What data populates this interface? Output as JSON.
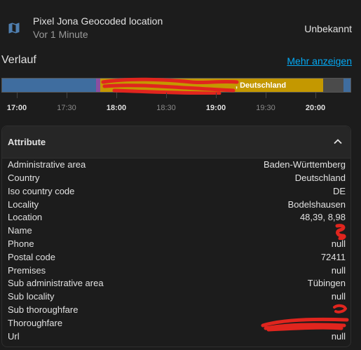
{
  "entity": {
    "name": "Pixel Jona Geocoded location",
    "last_changed": "Vor 1 Minute",
    "state": "Unbekannt",
    "icon": "map-icon"
  },
  "history": {
    "title": "Verlauf",
    "more_link": "Mehr anzeigen",
    "segment_label": ", Deutschland",
    "segment_colors": [
      "#3f6d9f",
      "#8c4ea0",
      "#c49800",
      "#4b4b4b",
      "#3f6d9f"
    ],
    "ticks": [
      "17:00",
      "17:30",
      "18:00",
      "18:30",
      "19:00",
      "19:30",
      "20:00"
    ]
  },
  "attributes": {
    "title": "Attribute",
    "rows": [
      {
        "key": "Administrative area",
        "value": "Baden-Württemberg"
      },
      {
        "key": "Country",
        "value": "Deutschland"
      },
      {
        "key": "Iso country code",
        "value": "DE"
      },
      {
        "key": "Locality",
        "value": "Bodelshausen"
      },
      {
        "key": "Location",
        "value": "48,39, 8,98"
      },
      {
        "key": "Name",
        "value": ""
      },
      {
        "key": "Phone",
        "value": "null"
      },
      {
        "key": "Postal code",
        "value": "72411"
      },
      {
        "key": "Premises",
        "value": "null"
      },
      {
        "key": "Sub administrative area",
        "value": "Tübingen"
      },
      {
        "key": "Sub locality",
        "value": "null"
      },
      {
        "key": "Sub thoroughfare",
        "value": ""
      },
      {
        "key": "Thoroughfare",
        "value": ""
      },
      {
        "key": "Url",
        "value": "null"
      }
    ]
  }
}
